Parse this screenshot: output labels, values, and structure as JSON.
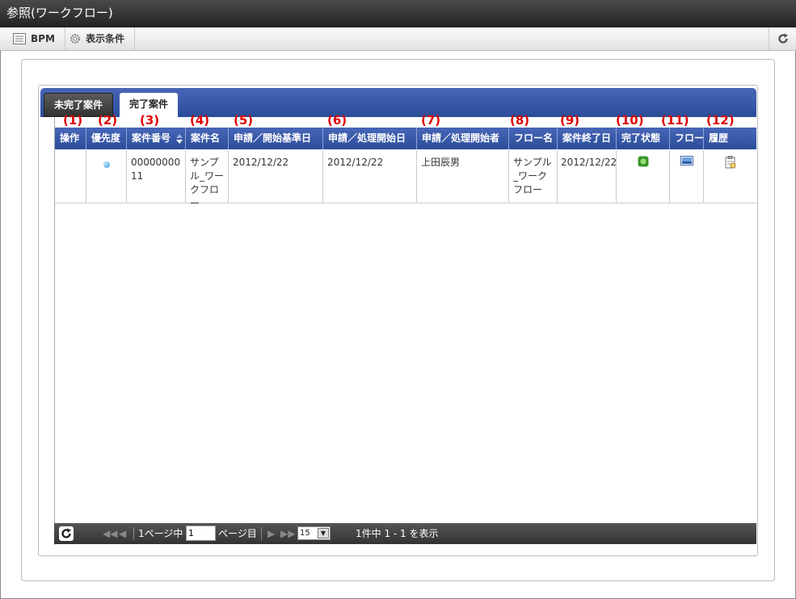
{
  "window": {
    "title": "参照(ワークフロー)"
  },
  "toolbar": {
    "bpm_label": "BPM",
    "display_conditions_label": "表示条件"
  },
  "tabs": [
    {
      "label": "未完了案件",
      "active": false
    },
    {
      "label": "完了案件",
      "active": true
    }
  ],
  "annotations": [
    "(1)",
    "(2)",
    "(3)",
    "(4)",
    "(5)",
    "(6)",
    "(7)",
    "(8)",
    "(9)",
    "(10)",
    "(11)",
    "(12)"
  ],
  "columns": [
    "操作",
    "優先度",
    "案件番号",
    "案件名",
    "申請／開始基準日",
    "申請／処理開始日",
    "申請／処理開始者",
    "フロー名",
    "案件終了日",
    "完了状態",
    "フロー",
    "履歴"
  ],
  "rows": [
    {
      "operation": "",
      "priority_icon": "blue-dot-icon",
      "case_number": "0000000011",
      "case_name": "サンプル_ワークフロー",
      "start_base_date": "2012/12/22",
      "process_start_date": "2012/12/22",
      "process_starter": "上田辰男",
      "flow_name": "サンプル_ワークフロー",
      "end_date": "2012/12/22",
      "completion_icon": "green-status-icon",
      "flow_icon": "flow-image-icon",
      "history_icon": "history-clipboard-icon"
    }
  ],
  "pager": {
    "page_prefix": "1ページ中",
    "page_input": "1",
    "page_suffix": "ページ目",
    "page_size": "15",
    "summary": "1件中 1 - 1 を表示"
  },
  "colors": {
    "header_blue": "#2a4d99",
    "annotation_red": "#e00000",
    "titlebar": "#2b2b2b"
  }
}
